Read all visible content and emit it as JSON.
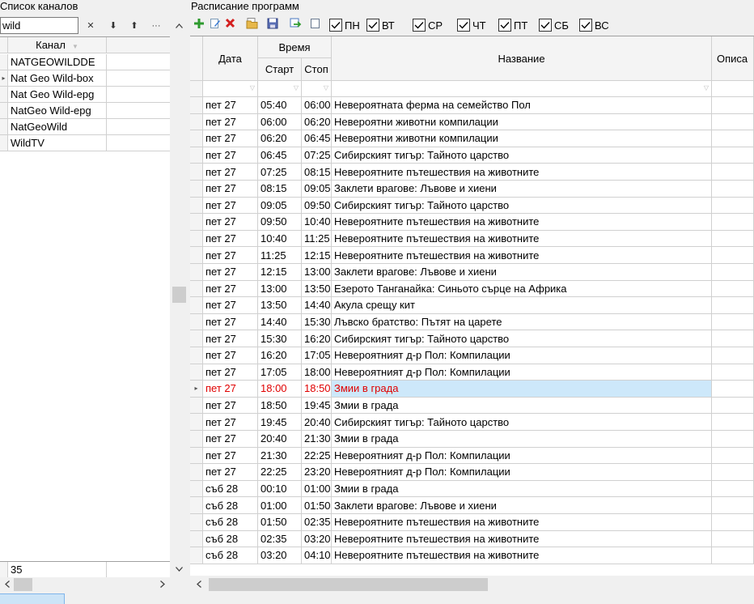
{
  "channels_panel": {
    "title": "Список каналов",
    "filter_value": "wild",
    "toolbar": {
      "clear": "✕",
      "down": "⬇",
      "up": "⬆",
      "more": "···"
    },
    "header": "Канал",
    "rows": [
      {
        "name": "NATGEOWILDDE",
        "current": false
      },
      {
        "name": "Nat Geo Wild-box",
        "current": true
      },
      {
        "name": "Nat Geo Wild-epg",
        "current": false
      },
      {
        "name": "NatGeo Wild-epg",
        "current": false
      },
      {
        "name": "NatGeoWild",
        "current": false
      },
      {
        "name": "WildTV",
        "current": false
      }
    ],
    "footer_count": "35"
  },
  "schedule_panel": {
    "title": "Расписание программ",
    "days": [
      {
        "label": "ПН",
        "checked": true
      },
      {
        "label": "ВТ",
        "checked": true
      },
      {
        "label": "СР",
        "checked": true
      },
      {
        "label": "ЧТ",
        "checked": true
      },
      {
        "label": "ПТ",
        "checked": true
      },
      {
        "label": "СБ",
        "checked": true
      },
      {
        "label": "ВС",
        "checked": true
      }
    ],
    "headers": {
      "date": "Дата",
      "time": "Время",
      "start": "Старт",
      "stop": "Стоп",
      "title": "Название",
      "description": "Описа"
    },
    "rows": [
      {
        "date": "пет 27",
        "start": "05:40",
        "stop": "06:00",
        "title": "Невероятната ферма на семейство Пол"
      },
      {
        "date": "пет 27",
        "start": "06:00",
        "stop": "06:20",
        "title": "Невероятни животни компилации"
      },
      {
        "date": "пет 27",
        "start": "06:20",
        "stop": "06:45",
        "title": "Невероятни животни компилации"
      },
      {
        "date": "пет 27",
        "start": "06:45",
        "stop": "07:25",
        "title": "Сибирският тигър: Тайното царство"
      },
      {
        "date": "пет 27",
        "start": "07:25",
        "stop": "08:15",
        "title": "Невероятните пътешествия на животните"
      },
      {
        "date": "пет 27",
        "start": "08:15",
        "stop": "09:05",
        "title": "Заклети врагове: Лъвове и хиени"
      },
      {
        "date": "пет 27",
        "start": "09:05",
        "stop": "09:50",
        "title": "Сибирският тигър: Тайното царство"
      },
      {
        "date": "пет 27",
        "start": "09:50",
        "stop": "10:40",
        "title": "Невероятните пътешествия на животните"
      },
      {
        "date": "пет 27",
        "start": "10:40",
        "stop": "11:25",
        "title": "Невероятните пътешествия на животните"
      },
      {
        "date": "пет 27",
        "start": "11:25",
        "stop": "12:15",
        "title": "Невероятните пътешествия на животните"
      },
      {
        "date": "пет 27",
        "start": "12:15",
        "stop": "13:00",
        "title": "Заклети врагове: Лъвове и хиени"
      },
      {
        "date": "пет 27",
        "start": "13:00",
        "stop": "13:50",
        "title": "Езерото Танганайка: Синьото сърце на Африка"
      },
      {
        "date": "пет 27",
        "start": "13:50",
        "stop": "14:40",
        "title": "Акула срещу кит"
      },
      {
        "date": "пет 27",
        "start": "14:40",
        "stop": "15:30",
        "title": "Лъвско братство: Пътят на царете"
      },
      {
        "date": "пет 27",
        "start": "15:30",
        "stop": "16:20",
        "title": "Сибирският тигър: Тайното царство"
      },
      {
        "date": "пет 27",
        "start": "16:20",
        "stop": "17:05",
        "title": "Невероятният д-р Пол: Компилации"
      },
      {
        "date": "пет 27",
        "start": "17:05",
        "stop": "18:00",
        "title": "Невероятният д-р Пол: Компилации"
      },
      {
        "date": "пет 27",
        "start": "18:00",
        "stop": "18:50",
        "title": "Змии в града",
        "selected": true
      },
      {
        "date": "пет 27",
        "start": "18:50",
        "stop": "19:45",
        "title": "Змии в града"
      },
      {
        "date": "пет 27",
        "start": "19:45",
        "stop": "20:40",
        "title": "Сибирският тигър: Тайното царство"
      },
      {
        "date": "пет 27",
        "start": "20:40",
        "stop": "21:30",
        "title": "Змии в града"
      },
      {
        "date": "пет 27",
        "start": "21:30",
        "stop": "22:25",
        "title": "Невероятният д-р Пол: Компилации"
      },
      {
        "date": "пет 27",
        "start": "22:25",
        "stop": "23:20",
        "title": "Невероятният д-р Пол: Компилации"
      },
      {
        "date": "съб 28",
        "start": "00:10",
        "stop": "01:00",
        "title": "Змии в града"
      },
      {
        "date": "съб 28",
        "start": "01:00",
        "stop": "01:50",
        "title": "Заклети врагове: Лъвове и хиени"
      },
      {
        "date": "съб 28",
        "start": "01:50",
        "stop": "02:35",
        "title": "Невероятните пътешествия на животните"
      },
      {
        "date": "съб 28",
        "start": "02:35",
        "stop": "03:20",
        "title": "Невероятните пътешествия на животните"
      },
      {
        "date": "съб 28",
        "start": "03:20",
        "stop": "04:10",
        "title": "Невероятните пътешествия на животните"
      }
    ]
  },
  "icons": {
    "add": "plus-icon",
    "edit": "edit-icon",
    "delete": "delete-icon",
    "folder": "folder-icon",
    "save": "save-icon",
    "export": "export-icon",
    "blank": "checkbox-icon"
  },
  "colors": {
    "selected_text": "#e00000",
    "selected_bg": "#cde8fa",
    "add_green": "#2e9a2e",
    "delete_red": "#d42020"
  }
}
